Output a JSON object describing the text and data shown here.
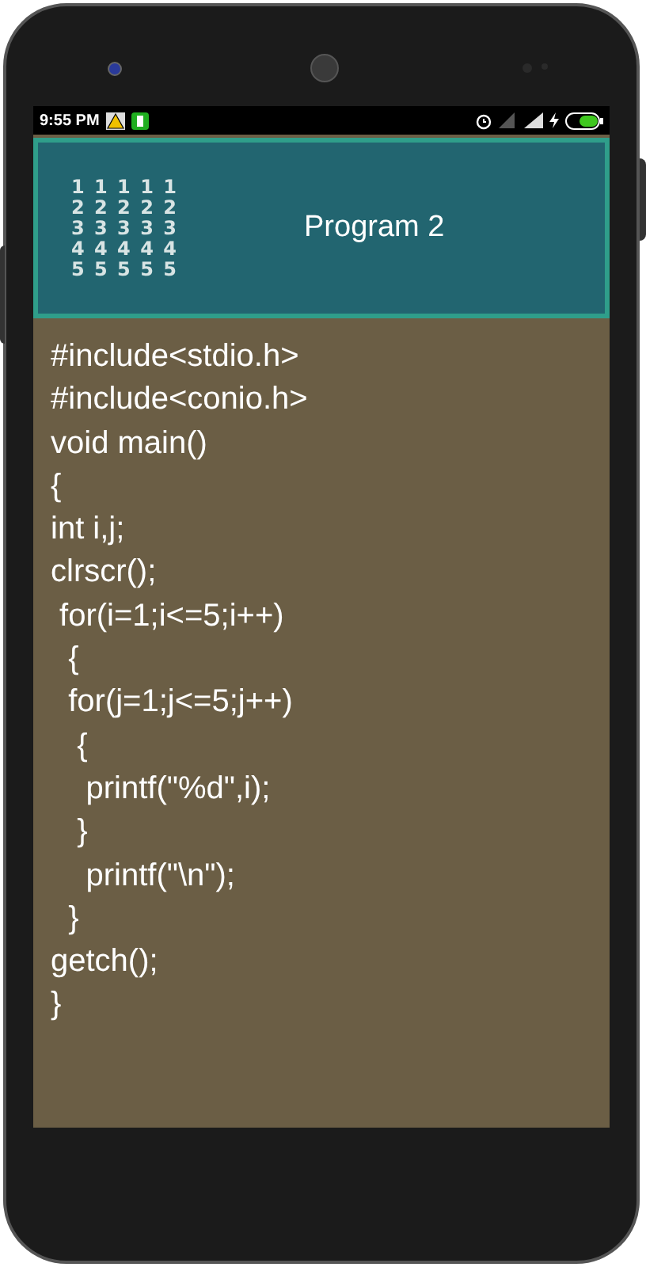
{
  "status_bar": {
    "time": "9:55 PM"
  },
  "header": {
    "output_lines": [
      "1 1 1 1 1",
      "2 2 2 2 2",
      "3 3 3 3 3",
      "4 4 4 4 4",
      "5 5 5 5 5"
    ],
    "title": "Program 2"
  },
  "code_lines": [
    "#include<stdio.h>",
    "#include<conio.h>",
    "void main()",
    "{",
    "int i,j;",
    "clrscr();",
    " for(i=1;i<=5;i++)",
    "  {",
    "  for(j=1;j<=5;j++)",
    "   {",
    "    printf(\"%d\",i);",
    "   }",
    "    printf(\"\\n\");",
    "  }",
    "getch();",
    "}"
  ]
}
